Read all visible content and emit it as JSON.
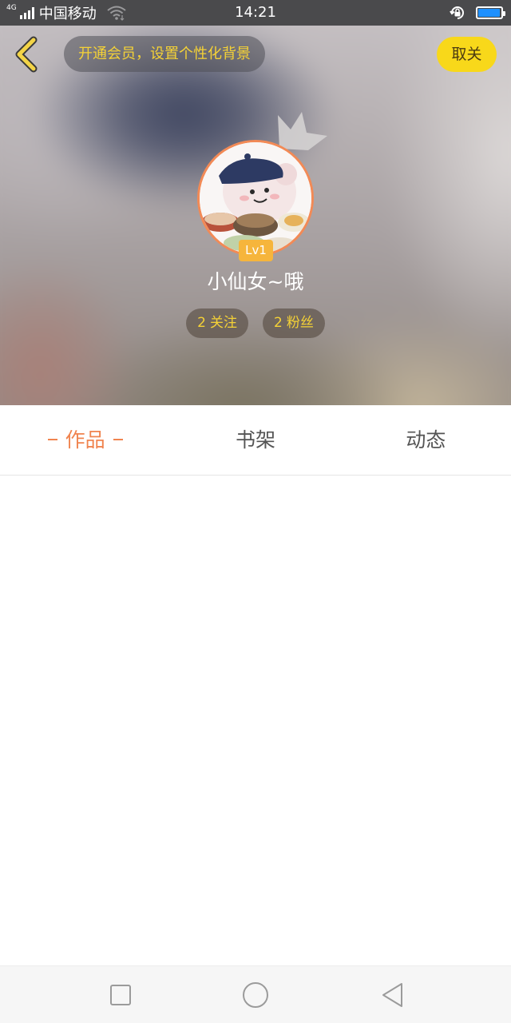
{
  "status_bar": {
    "network_type": "4G",
    "carrier": "中国移动",
    "time": "14:21",
    "battery_level": 0.95,
    "icons": [
      "signal-icon",
      "wifi-icon",
      "rotation-lock-icon",
      "battery-icon"
    ]
  },
  "header": {
    "vip_banner": "开通会员，设置个性化背景",
    "unfollow_label": "取关",
    "back_icon": "chevron-left-icon",
    "level": "Lv1",
    "nickname": "小仙女~哦",
    "following": {
      "count": "2",
      "label": "关注"
    },
    "followers": {
      "count": "2",
      "label": "粉丝"
    }
  },
  "tabs": [
    {
      "label": "作品",
      "active": true
    },
    {
      "label": "书架",
      "active": false
    },
    {
      "label": "动态",
      "active": false
    }
  ],
  "nav_bar": {
    "icons": [
      "recents-square-icon",
      "home-circle-icon",
      "back-triangle-icon"
    ]
  },
  "colors": {
    "accent": "#f0844f",
    "vip_text": "#f5d236",
    "unfollow_bg": "#f8d81a",
    "level_badge": "#f6b53c",
    "battery": "#1e90ff"
  }
}
